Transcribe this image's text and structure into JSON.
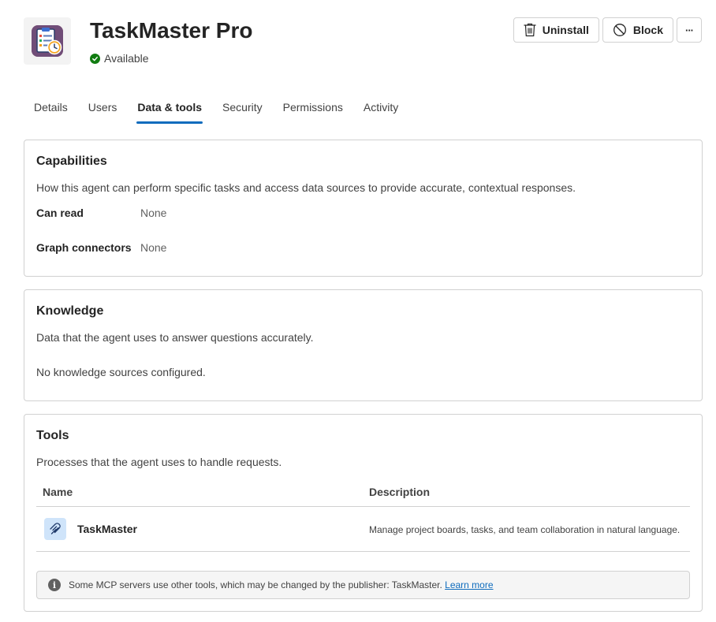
{
  "app": {
    "title": "TaskMaster Pro",
    "status": "Available",
    "icon": "clipboard-clock-app-icon"
  },
  "actions": {
    "uninstall_label": "Uninstall",
    "block_label": "Block",
    "more_label": "···"
  },
  "tabs": [
    {
      "label": "Details",
      "active": false
    },
    {
      "label": "Users",
      "active": false
    },
    {
      "label": "Data & tools",
      "active": true
    },
    {
      "label": "Security",
      "active": false
    },
    {
      "label": "Permissions",
      "active": false
    },
    {
      "label": "Activity",
      "active": false
    }
  ],
  "capabilities": {
    "title": "Capabilities",
    "description": "How this agent can perform specific tasks and access data sources to provide accurate, contextual responses.",
    "rows": [
      {
        "label": "Can read",
        "value": "None"
      },
      {
        "label": "Graph connectors",
        "value": "None"
      }
    ]
  },
  "knowledge": {
    "title": "Knowledge",
    "description": "Data that the agent uses to answer questions accurately.",
    "empty_text": "No knowledge sources configured."
  },
  "tools": {
    "title": "Tools",
    "description": "Processes that the agent uses to handle requests.",
    "columns": {
      "name": "Name",
      "description": "Description"
    },
    "rows": [
      {
        "name": "TaskMaster",
        "description": "Manage project boards, tasks, and team collaboration in natural language.",
        "icon": "mcp-server-icon"
      }
    ],
    "info": {
      "text": "Some MCP servers use other tools, which may be changed by the publisher: TaskMaster.",
      "link": "Learn more"
    }
  },
  "colors": {
    "accent": "#0f6cbd",
    "success": "#107c10",
    "border": "#d1d1d1"
  }
}
